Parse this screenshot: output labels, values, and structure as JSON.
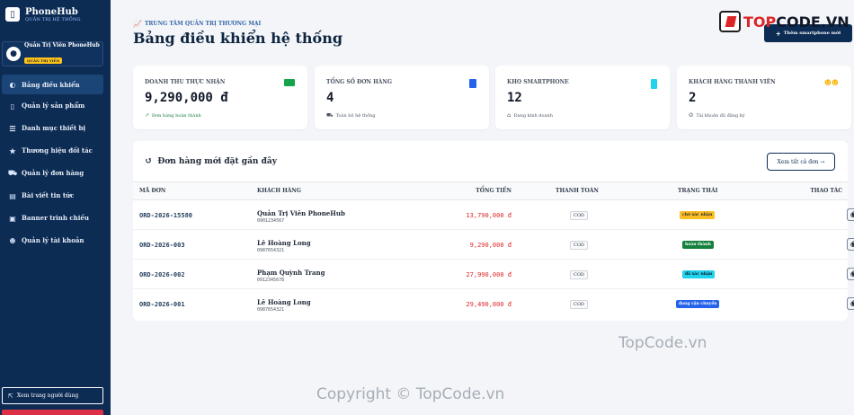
{
  "sidebar": {
    "brand": "PhoneHub",
    "brand_sub": "QUẢN TRỊ HỆ THỐNG",
    "user_name": "Quản Trị Viên PhoneHub",
    "user_role": "QUẢN TRỊ VIÊN",
    "items": [
      {
        "label": "Bảng điều khiển",
        "icon": "gauge-icon"
      },
      {
        "label": "Quản lý sản phẩm",
        "icon": "phone-icon"
      },
      {
        "label": "Danh mục thiết bị",
        "icon": "list-icon"
      },
      {
        "label": "Thương hiệu đối tác",
        "icon": "star-icon"
      },
      {
        "label": "Quản lý đơn hàng",
        "icon": "truck-icon"
      },
      {
        "label": "Bài viết tin tức",
        "icon": "news-icon"
      },
      {
        "label": "Banner trình chiếu",
        "icon": "image-icon"
      },
      {
        "label": "Quản lý tài khoản",
        "icon": "users-icon"
      }
    ],
    "view_user": "Xem trang người dùng"
  },
  "header": {
    "breadcrumb": "TRUNG TÂM QUẢN TRỊ THƯƠNG MẠI",
    "title": "Bảng điều khiển hệ thống",
    "add_button": "Thêm smartphone mới"
  },
  "stats": [
    {
      "label": "DOANH THU THỰC NHẬN",
      "value": "9,290,000 đ",
      "sub": "Đơn hàng hoàn thành"
    },
    {
      "label": "TỔNG SỐ ĐƠN HÀNG",
      "value": "4",
      "sub": "Toàn bộ hệ thống"
    },
    {
      "label": "KHO SMARTPHONE",
      "value": "12",
      "sub": "Đang kinh doanh"
    },
    {
      "label": "KHÁCH HÀNG THÀNH VIÊN",
      "value": "2",
      "sub": "Tài khoản đã đăng ký"
    }
  ],
  "orders": {
    "title": "Đơn hàng mới đặt gần đây",
    "view_all": "Xem tất cả đơn →",
    "columns": {
      "id": "MÃ ĐƠN",
      "customer": "KHÁCH HÀNG",
      "total": "TỔNG TIỀN",
      "payment": "THANH TOÁN",
      "status": "TRẠNG THÁI",
      "actions": "THAO TÁC"
    },
    "rows": [
      {
        "id": "ORD-2026-15580",
        "name": "Quản Trị Viên PhoneHub",
        "phone": "0901234567",
        "total": "13,790,000 đ",
        "payment": "COD",
        "status": "chờ xác nhận",
        "status_bg": "#fbbf24",
        "status_fg": "#1f2937"
      },
      {
        "id": "ORD-2026-003",
        "name": "Lê Hoàng Long",
        "phone": "0987654321",
        "total": "9,290,000 đ",
        "payment": "COD",
        "status": "hoàn thành",
        "status_bg": "#15803d",
        "status_fg": "#ffffff"
      },
      {
        "id": "ORD-2026-002",
        "name": "Phạm Quỳnh Trang",
        "phone": "0912345678",
        "total": "27,990,000 đ",
        "payment": "COD",
        "status": "đã xác nhận",
        "status_bg": "#22d3ee",
        "status_fg": "#0f172a"
      },
      {
        "id": "ORD-2026-001",
        "name": "Lê Hoàng Long",
        "phone": "0987654321",
        "total": "29,490,000 đ",
        "payment": "COD",
        "status": "đang vận chuyển",
        "status_bg": "#2563eb",
        "status_fg": "#ffffff"
      }
    ]
  },
  "watermarks": {
    "topcode": "TopCode.vn",
    "copyright": "Copyright © TopCode.vn",
    "logo_red": "TOP",
    "logo_dark": "CODE.VN"
  }
}
